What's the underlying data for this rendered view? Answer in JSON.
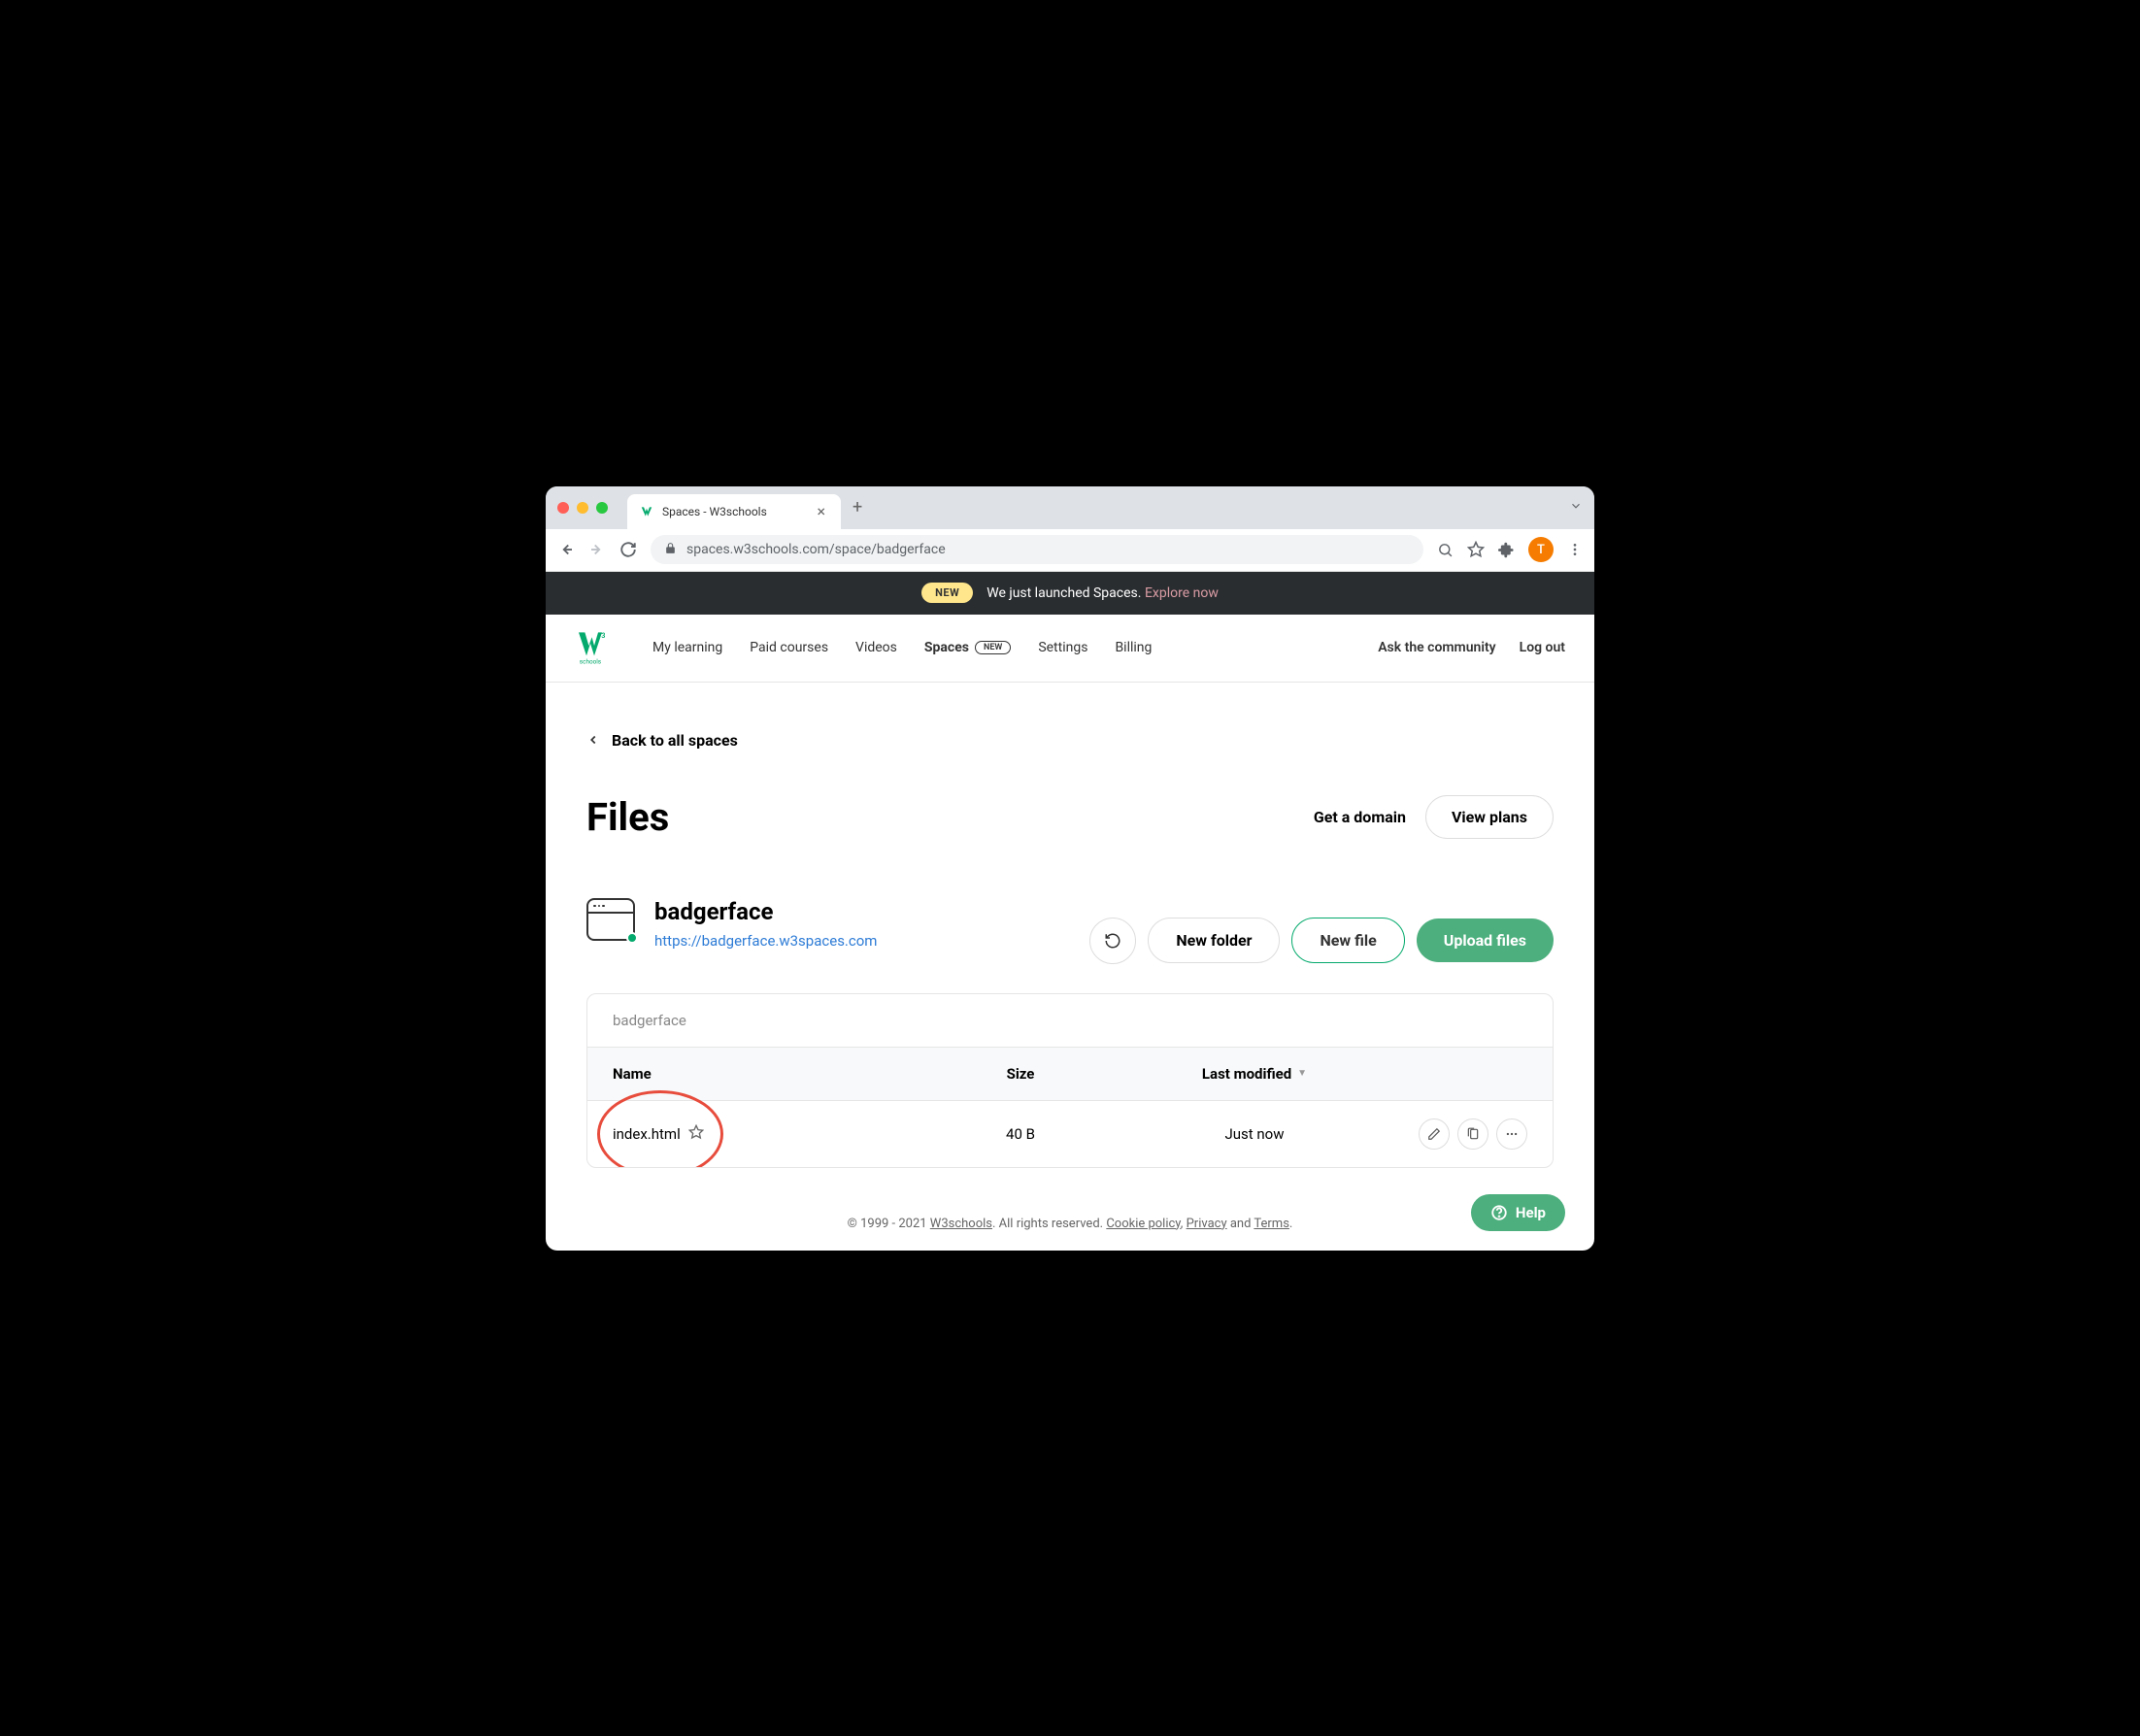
{
  "browser": {
    "tab_title": "Spaces - W3schools",
    "url_host": "spaces.w3schools.com",
    "url_path": "/space/badgerface",
    "avatar_letter": "T"
  },
  "announce": {
    "badge": "NEW",
    "text": "We just launched Spaces.",
    "link": "Explore now"
  },
  "nav": {
    "items": [
      "My learning",
      "Paid courses",
      "Videos",
      "Spaces",
      "Settings",
      "Billing"
    ],
    "spaces_pill": "NEW",
    "right": [
      "Ask the community",
      "Log out"
    ]
  },
  "page": {
    "back": "Back to all spaces",
    "title": "Files",
    "get_domain": "Get a domain",
    "view_plans": "View plans"
  },
  "space": {
    "name": "badgerface",
    "url": "https://badgerface.w3spaces.com",
    "new_folder": "New folder",
    "new_file": "New file",
    "upload": "Upload files"
  },
  "table": {
    "breadcrumb": "badgerface",
    "headers": {
      "name": "Name",
      "size": "Size",
      "modified": "Last modified"
    },
    "rows": [
      {
        "name": "index.html",
        "size": "40 B",
        "modified": "Just now"
      }
    ]
  },
  "footer": {
    "copyright": "© 1999 - 2021 ",
    "brand": "W3schools",
    "rights": ". All rights reserved. ",
    "cookie": "Cookie policy",
    "sep1": ", ",
    "privacy": "Privacy",
    "sep2": " and ",
    "terms": "Terms",
    "end": "."
  },
  "help": {
    "label": "Help"
  }
}
